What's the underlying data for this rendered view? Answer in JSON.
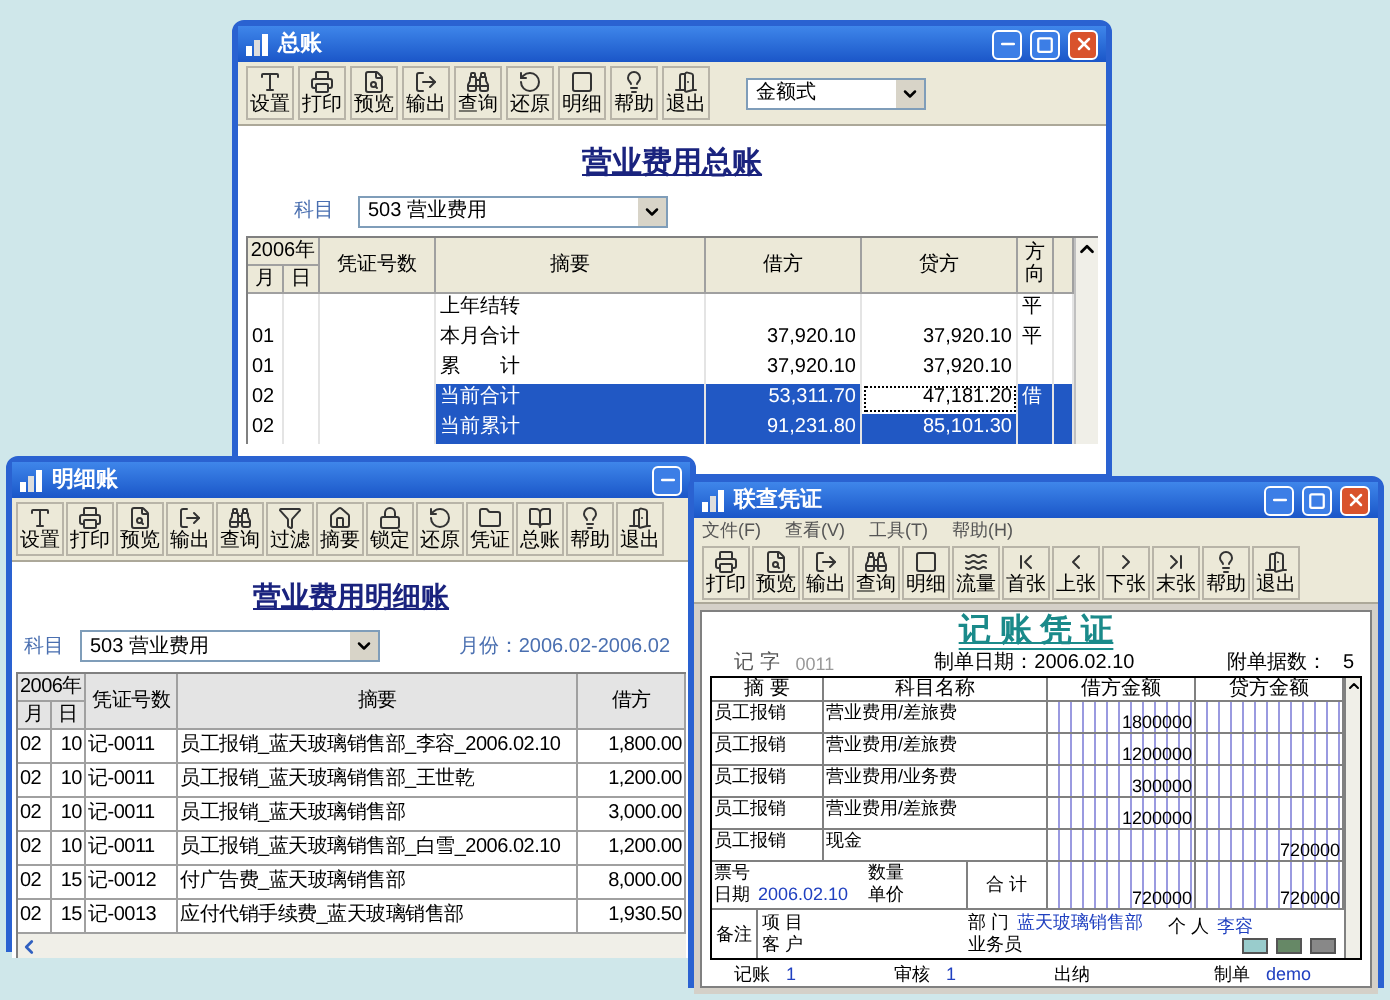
{
  "general_ledger_window": {
    "title": "总账",
    "toolbar": [
      {
        "kind": "settings",
        "label": "设置"
      },
      {
        "kind": "print",
        "label": "打印"
      },
      {
        "kind": "preview",
        "label": "预览"
      },
      {
        "kind": "export",
        "label": "输出"
      },
      {
        "kind": "query",
        "label": "查询"
      },
      {
        "kind": "restore",
        "label": "还原"
      },
      {
        "kind": "detail",
        "label": "明细"
      },
      {
        "kind": "help",
        "label": "帮助"
      },
      {
        "kind": "exit",
        "label": "退出"
      }
    ],
    "format_select": "金额式",
    "heading": "营业费用总账",
    "subject_label": "科目",
    "subject_select": "503 营业费用",
    "table": {
      "year_header": "2006年",
      "month_header": "月",
      "day_header": "日",
      "columns": [
        "凭证号数",
        "摘要",
        "借方",
        "贷方",
        "方向"
      ],
      "rows": [
        {
          "summary": "上年结转",
          "direction": "平",
          "selected": false,
          "focused": false
        },
        {
          "month": "01",
          "summary": "本月合计",
          "debit": "37,920.10",
          "credit": "37,920.10",
          "direction": "平",
          "selected": false,
          "focused": false
        },
        {
          "month": "01",
          "summary": "累　　计",
          "debit": "37,920.10",
          "credit": "37,920.10",
          "selected": false,
          "focused": false
        },
        {
          "month": "02",
          "summary": "当前合计",
          "debit": "53,311.70",
          "credit": "47,181.20",
          "direction": "借",
          "selected": true,
          "focused": true
        },
        {
          "month": "02",
          "summary": "当前累计",
          "debit": "91,231.80",
          "credit": "85,101.30",
          "selected": true,
          "focused": false
        }
      ]
    }
  },
  "detail_ledger_window": {
    "title": "明细账",
    "toolbar": [
      {
        "kind": "settings",
        "label": "设置"
      },
      {
        "kind": "print",
        "label": "打印"
      },
      {
        "kind": "preview",
        "label": "预览"
      },
      {
        "kind": "export",
        "label": "输出"
      },
      {
        "kind": "query",
        "label": "查询"
      },
      {
        "kind": "filter",
        "label": "过滤"
      },
      {
        "kind": "summary",
        "label": "摘要"
      },
      {
        "kind": "lock",
        "label": "锁定"
      },
      {
        "kind": "restore",
        "label": "还原"
      },
      {
        "kind": "voucher",
        "label": "凭证"
      },
      {
        "kind": "ledger",
        "label": "总账"
      },
      {
        "kind": "help",
        "label": "帮助"
      },
      {
        "kind": "exit",
        "label": "退出"
      }
    ],
    "heading": "营业费用明细账",
    "subject_label": "科目",
    "subject_select": "503 营业费用",
    "period": "月份：2006.02-2006.02",
    "table": {
      "year_header": "2006年",
      "month_header": "月",
      "day_header": "日",
      "columns": [
        "凭证号数",
        "摘要",
        "借方"
      ],
      "rows": [
        {
          "month": "02",
          "day": "10",
          "voucher": "记-0011",
          "summary": "员工报销_蓝天玻璃销售部_李容_2006.02.10",
          "debit": "1,800.00"
        },
        {
          "month": "02",
          "day": "10",
          "voucher": "记-0011",
          "summary": "员工报销_蓝天玻璃销售部_王世乾",
          "debit": "1,200.00"
        },
        {
          "month": "02",
          "day": "10",
          "voucher": "记-0011",
          "summary": "员工报销_蓝天玻璃销售部",
          "debit": "3,000.00"
        },
        {
          "month": "02",
          "day": "10",
          "voucher": "记-0011",
          "summary": "员工报销_蓝天玻璃销售部_白雪_2006.02.10",
          "debit": "1,200.00"
        },
        {
          "month": "02",
          "day": "15",
          "voucher": "记-0012",
          "summary": "付广告费_蓝天玻璃销售部",
          "debit": "8,000.00"
        },
        {
          "month": "02",
          "day": "15",
          "voucher": "记-0013",
          "summary": "应付代销手续费_蓝天玻璃销售部",
          "debit": "1,930.50"
        }
      ]
    }
  },
  "voucher_window": {
    "title": "联查凭证",
    "menu": [
      "文件(F)",
      "查看(V)",
      "工具(T)",
      "帮助(H)"
    ],
    "toolbar": [
      {
        "kind": "print",
        "label": "打印"
      },
      {
        "kind": "preview",
        "label": "预览"
      },
      {
        "kind": "export",
        "label": "输出"
      },
      {
        "kind": "query",
        "label": "查询"
      },
      {
        "kind": "detail",
        "label": "明细"
      },
      {
        "kind": "flow",
        "label": "流量"
      },
      {
        "kind": "first",
        "label": "首张"
      },
      {
        "kind": "previous",
        "label": "上张"
      },
      {
        "kind": "next",
        "label": "下张"
      },
      {
        "kind": "last",
        "label": "末张"
      },
      {
        "kind": "help",
        "label": "帮助"
      },
      {
        "kind": "exit",
        "label": "退出"
      }
    ],
    "voucher": {
      "title": "记 账 凭 证",
      "type_label": "记 字",
      "number": "0011",
      "date_label": "制单日期：2006.02.10",
      "attachments_label": "附单据数：",
      "attachments": "5",
      "columns": [
        "摘 要",
        "科目名称",
        "借方金额",
        "贷方金额"
      ],
      "entries": [
        {
          "summary": "员工报销",
          "account": "营业费用/差旅费",
          "debit": "1800000"
        },
        {
          "summary": "员工报销",
          "account": "营业费用/差旅费",
          "debit": "1200000"
        },
        {
          "summary": "员工报销",
          "account": "营业费用/业务费",
          "debit": "300000"
        },
        {
          "summary": "员工报销",
          "account": "营业费用/差旅费",
          "debit": "1200000"
        },
        {
          "summary": "员工报销",
          "account": "现金",
          "credit": "720000"
        }
      ],
      "ticket_label": "票号",
      "date_field_label": "日期",
      "date_field_value": "2006.02.10",
      "quantity_label": "数量",
      "unit_price_label": "单价",
      "total_label": "合 计",
      "debit_total": "720000",
      "credit_total": "720000",
      "remark_label": "备注",
      "project_label": "项 目",
      "customer_label": "客 户",
      "department_label": "部 门",
      "department": "蓝天玻璃销售部",
      "person_label": "个 人",
      "person": "李容",
      "salesperson_label": "业务员",
      "signatures": [
        {
          "label": "记账",
          "value": "1"
        },
        {
          "label": "审核",
          "value": "1"
        },
        {
          "label": "出纳"
        },
        {
          "label": "制单",
          "value": "demo"
        }
      ]
    }
  }
}
